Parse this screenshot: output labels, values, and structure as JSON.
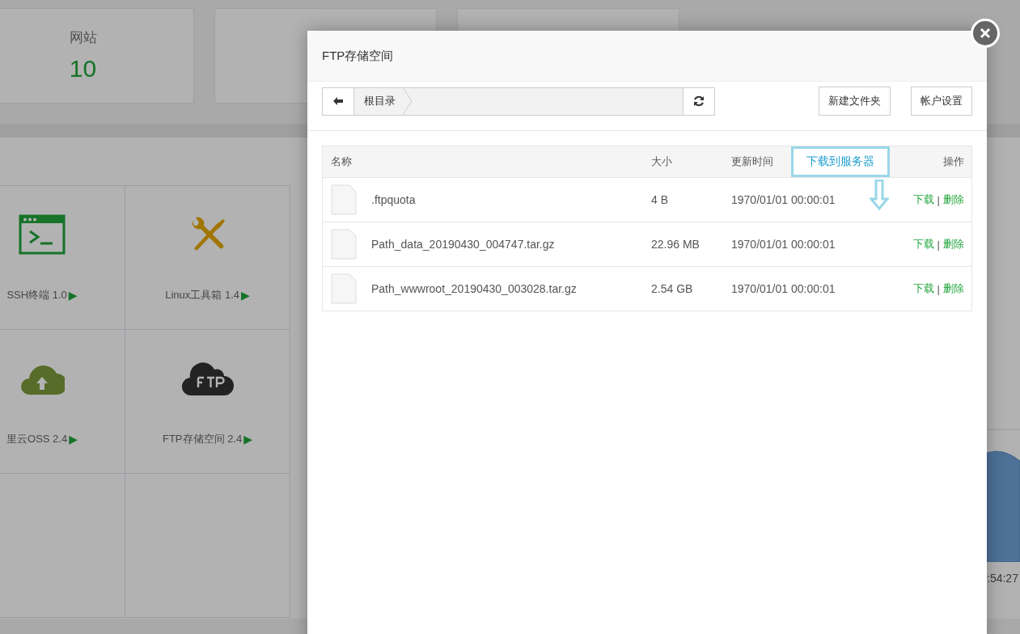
{
  "background": {
    "stats": [
      {
        "label": "网站",
        "value": "10"
      }
    ],
    "plugins": [
      {
        "name": "SSH终端 1.0",
        "kind": "terminal"
      },
      {
        "name": "Linux工具箱 1.4",
        "kind": "tools"
      },
      {
        "name": "里云OSS 2.4",
        "kind": "cloud-upload"
      },
      {
        "name": "FTP存储空间 2.4",
        "kind": "ftp-cloud"
      }
    ],
    "plugin_marker": "▶",
    "chart_label": ":54:27"
  },
  "modal": {
    "title": "FTP存储空间",
    "breadcrumb": "根目录",
    "buttons": [
      "新建文件夹",
      "帐户设置"
    ],
    "columns": [
      {
        "label": "名称",
        "highlighted": false
      },
      {
        "label": "大小",
        "highlighted": false
      },
      {
        "label": "更新时间",
        "highlighted": false
      },
      {
        "label": "下载到服务器",
        "highlighted": true
      },
      {
        "label": "操作",
        "highlighted": false
      }
    ],
    "rows": [
      {
        "name": ".ftpquota",
        "size": "4 B",
        "time": "1970/01/01 00:00:01",
        "download": "下载",
        "separator": "|",
        "delete": "删除"
      },
      {
        "name": "Path_data_20190430_004747.tar.gz",
        "size": "22.96 MB",
        "time": "1970/01/01 00:00:01",
        "download": "下载",
        "separator": "|",
        "delete": "删除"
      },
      {
        "name": "Path_wwwroot_20190430_003028.tar.gz",
        "size": "2.54 GB",
        "time": "1970/01/01 00:00:01",
        "download": "下载",
        "separator": "|",
        "delete": "删除"
      }
    ]
  }
}
